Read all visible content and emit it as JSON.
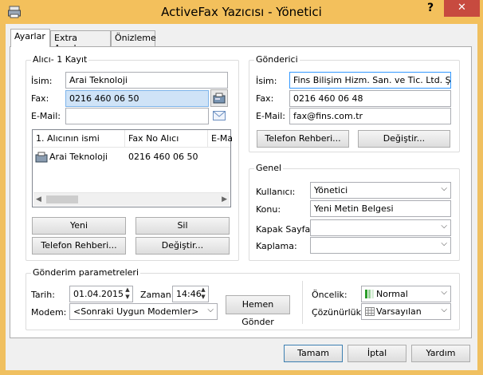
{
  "window": {
    "title": "ActiveFax Yazıcısı - Yönetici",
    "help": "?",
    "close": "✕"
  },
  "tabs": [
    {
      "label": "Ayarlar"
    },
    {
      "label": "Extra Ayarlar"
    },
    {
      "label": "Önizleme"
    }
  ],
  "recipient": {
    "group_label": "Alıcı- 1 Kayıt",
    "name_label": "İsim:",
    "name_value": "Arai Teknoloji",
    "fax_label": "Fax:",
    "fax_value": "0216 460 06 50",
    "email_label": "E-Mail:",
    "email_value": "",
    "list": {
      "columns": [
        "1. Alıcının ismi",
        "Fax No Alıcı",
        "E-Ma"
      ],
      "rows": [
        {
          "name": "Arai Teknoloji",
          "fax": "0216 460 06 50"
        }
      ]
    },
    "new_btn": "Yeni",
    "delete_btn": "Sil",
    "phonebook_btn": "Telefon Rehberi...",
    "change_btn": "Değiştir..."
  },
  "sender": {
    "group_label": "Gönderici",
    "name_label": "İsim:",
    "name_value": "Fins Bilişim Hizm. San. ve Tic. Ltd. Şti.",
    "fax_label": "Fax:",
    "fax_value": "0216 460 06 48",
    "email_label": "E-Mail:",
    "email_value": "fax@fins.com.tr",
    "phonebook_btn": "Telefon Rehberi...",
    "change_btn": "Değiştir..."
  },
  "general": {
    "group_label": "Genel",
    "user_label": "Kullanıcı:",
    "user_value": "Yönetici",
    "subject_label": "Konu:",
    "subject_value": "Yeni Metin Belgesi",
    "cover_label": "Kapak Sayfa:",
    "cover_value": "",
    "overlay_label": "Kaplama:",
    "overlay_value": ""
  },
  "send_params": {
    "group_label": "Gönderim parametreleri",
    "date_label": "Tarih:",
    "date_value": "01.04.2015",
    "time_label": "Zaman:",
    "time_value": "14:46",
    "modem_label": "Modem:",
    "modem_value": "<Sonraki Uygun Modemler>",
    "send_now_btn": "Hemen Gönder",
    "priority_label": "Öncelik:",
    "priority_value": "Normal",
    "resolution_label": "Çözünürlük:",
    "resolution_value": "Varsayılan"
  },
  "footer": {
    "ok_btn": "Tamam",
    "cancel_btn": "İptal",
    "help_btn": "Yardım"
  }
}
